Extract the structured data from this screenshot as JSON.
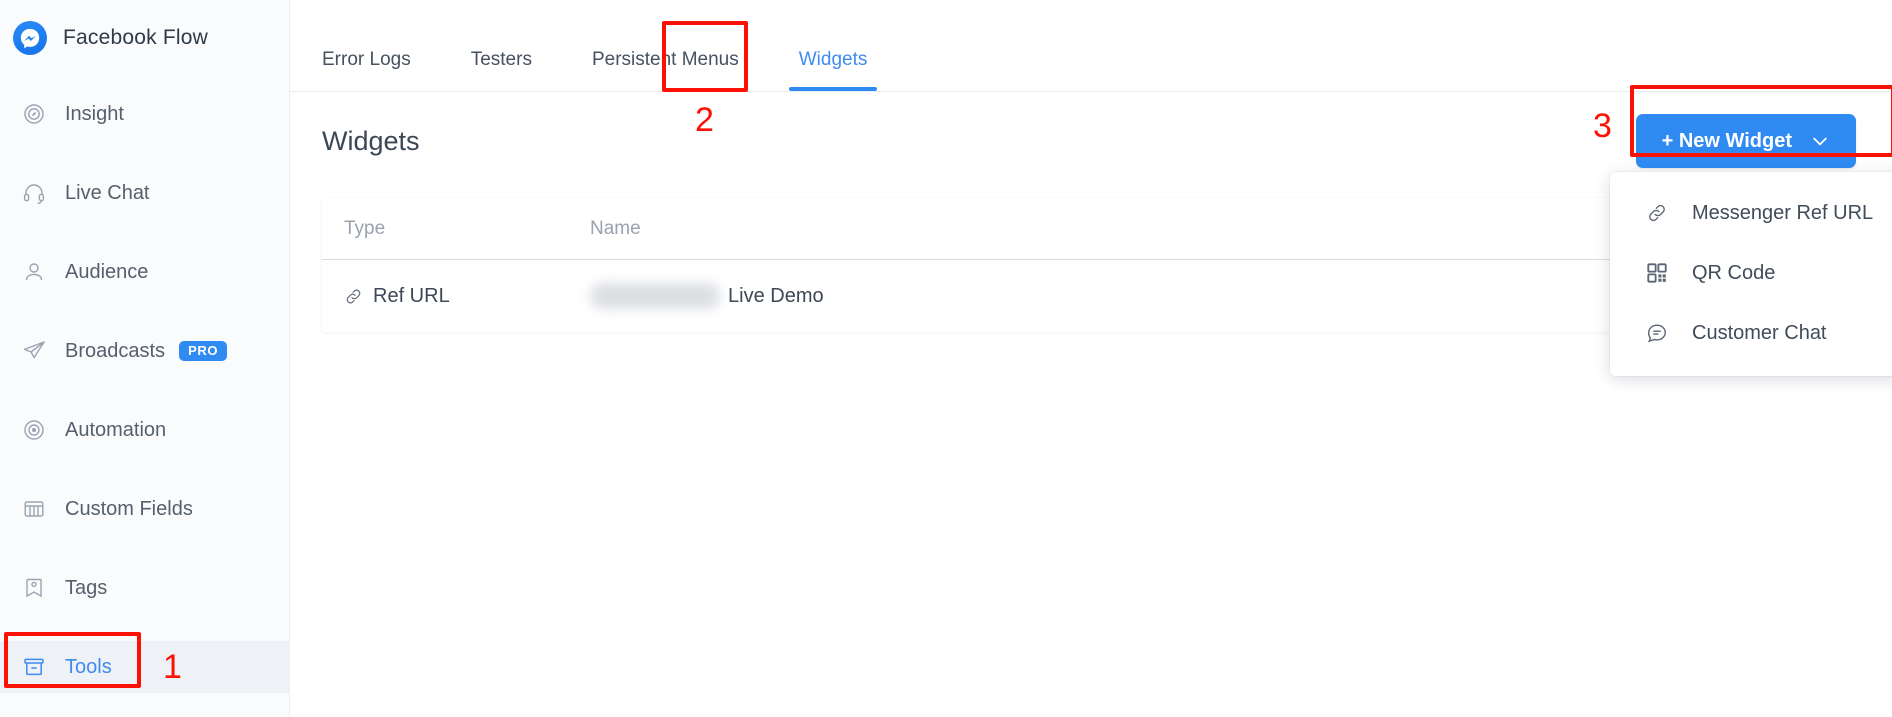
{
  "sidebar": {
    "brand": {
      "label": "Facebook Flow",
      "icon": "messenger-logo-icon"
    },
    "items": [
      {
        "label": "Insight",
        "icon": "insight-icon",
        "active": false,
        "badge": ""
      },
      {
        "label": "Live Chat",
        "icon": "headset-icon",
        "active": false,
        "badge": ""
      },
      {
        "label": "Audience",
        "icon": "user-icon",
        "active": false,
        "badge": ""
      },
      {
        "label": "Broadcasts",
        "icon": "paper-plane-icon",
        "active": false,
        "badge": "PRO"
      },
      {
        "label": "Automation",
        "icon": "automation-icon",
        "active": false,
        "badge": ""
      },
      {
        "label": "Custom Fields",
        "icon": "custom-fields-icon",
        "active": false,
        "badge": ""
      },
      {
        "label": "Tags",
        "icon": "tag-icon",
        "active": false,
        "badge": ""
      },
      {
        "label": "Tools",
        "icon": "tools-icon",
        "active": true,
        "badge": ""
      }
    ]
  },
  "annotations": {
    "step1": "1",
    "step2": "2",
    "step3": "3",
    "color": "#fb1205"
  },
  "tabs": [
    {
      "label": "Error Logs",
      "active": false
    },
    {
      "label": "Testers",
      "active": false
    },
    {
      "label": "Persistent Menus",
      "active": false
    },
    {
      "label": "Widgets",
      "active": true
    }
  ],
  "page": {
    "title": "Widgets",
    "new_widget_button": "+ New Widget",
    "chevron": "chevron-down-icon"
  },
  "dropdown": {
    "open": true,
    "items": [
      {
        "label": "Messenger Ref URL",
        "icon": "link-icon"
      },
      {
        "label": "QR Code",
        "icon": "qr-code-icon"
      },
      {
        "label": "Customer Chat",
        "icon": "chat-bubble-icon"
      }
    ]
  },
  "table": {
    "columns": [
      "Type",
      "Name"
    ],
    "rows": [
      {
        "type": "Ref URL",
        "type_icon": "link-icon",
        "name_redacted": true,
        "name": "Live Demo"
      }
    ]
  },
  "colors": {
    "accent": "#2f8bf2",
    "annotation": "#fb1205",
    "sidebar_bg": "#fafbfd",
    "text": "#3d4856"
  }
}
